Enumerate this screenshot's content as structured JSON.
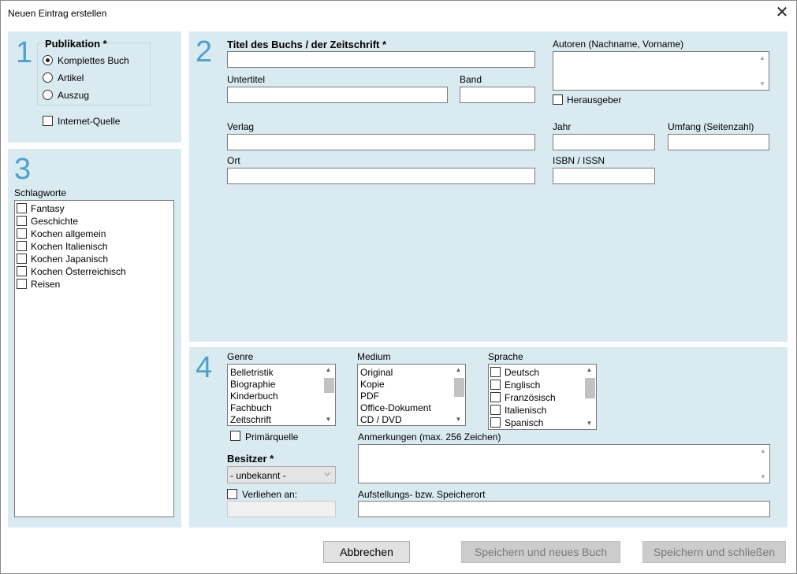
{
  "window": {
    "title": "Neuen Eintrag erstellen",
    "close_glyph": "✕"
  },
  "section_numbers": {
    "s1": "1",
    "s2": "2",
    "s3": "3",
    "s4": "4"
  },
  "publication": {
    "heading": "Publikation *",
    "options": [
      "Komplettes Buch",
      "Artikel",
      "Auszug"
    ],
    "selected": "Komplettes Buch",
    "internet_source": "Internet-Quelle"
  },
  "book": {
    "title_label": "Titel des Buchs / der Zeitschrift *",
    "title_value": "",
    "subtitle_label": "Untertitel",
    "volume_label": "Band",
    "authors_label": "Autoren (Nachname, Vorname)",
    "editor_label": "Herausgeber",
    "publisher_label": "Verlag",
    "year_label": "Jahr",
    "pages_label": "Umfang (Seitenzahl)",
    "place_label": "Ort",
    "isbn_label": "ISBN / ISSN"
  },
  "keywords": {
    "label": "Schlagworte",
    "items": [
      "Fantasy",
      "Geschichte",
      "Kochen allgemein",
      "Kochen Italienisch",
      "Kochen Japanisch",
      "Kochen Österreichisch",
      "Reisen"
    ]
  },
  "details": {
    "genre_label": "Genre",
    "genre_items": [
      "Belletristik",
      "Biographie",
      "Kinderbuch",
      "Fachbuch",
      "Zeitschrift"
    ],
    "medium_label": "Medium",
    "medium_items": [
      "Original",
      "Kopie",
      "PDF",
      "Office-Dokument",
      "CD / DVD"
    ],
    "language_label": "Sprache",
    "language_items": [
      "Deutsch",
      "Englisch",
      "Französisch",
      "Italienisch",
      "Spanisch"
    ],
    "primary_source_label": "Primärquelle",
    "owner_label": "Besitzer *",
    "owner_value": "- unbekannt -",
    "lent_label": "Verliehen an:",
    "notes_label": "Anmerkungen (max. 256 Zeichen)",
    "location_label": "Aufstellungs- bzw. Speicherort"
  },
  "buttons": {
    "cancel": "Abbrechen",
    "save_new": "Speichern und neues Buch",
    "save_close": "Speichern und schließen"
  },
  "colors": {
    "panel": "#d9eaf1",
    "section_number": "#4fa1c9"
  }
}
